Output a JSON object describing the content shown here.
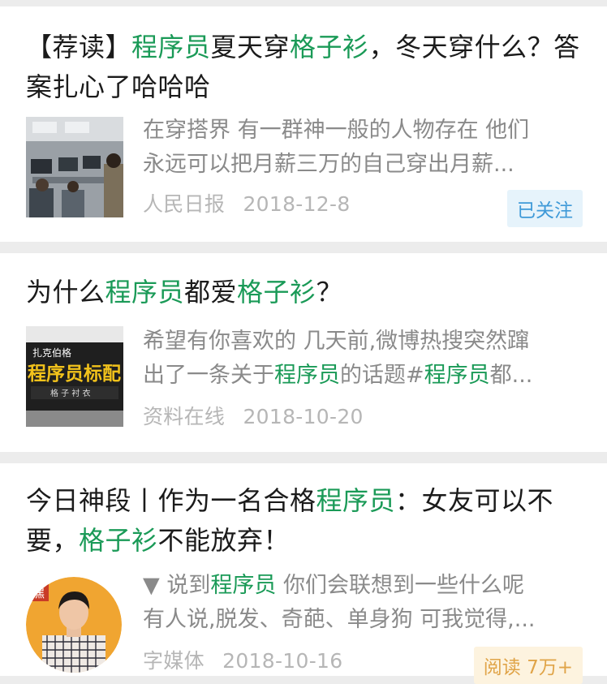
{
  "articles": [
    {
      "title_parts": [
        {
          "text": "【荐读】",
          "hl": false
        },
        {
          "text": "程序员",
          "hl": true
        },
        {
          "text": "夏天穿",
          "hl": false
        },
        {
          "text": "格子衫",
          "hl": true
        },
        {
          "text": "，冬天穿什么？答案扎心了哈哈哈",
          "hl": false
        }
      ],
      "summary_line1": [
        {
          "text": "在穿搭界 有一群神一般的人物存在 他们",
          "hl": false
        }
      ],
      "summary_line2": [
        {
          "text": "永远可以把月薪三万的自己穿出月薪...",
          "hl": false
        }
      ],
      "source": "人民日报",
      "date": "2018-12-8",
      "badge": "已关注"
    },
    {
      "title_parts": [
        {
          "text": "为什么",
          "hl": false
        },
        {
          "text": "程序员",
          "hl": true
        },
        {
          "text": "都爱",
          "hl": false
        },
        {
          "text": "格子衫",
          "hl": true
        },
        {
          "text": "？",
          "hl": false
        }
      ],
      "thumb_text": {
        "top_label": "扎克伯格",
        "main": "程序员标配",
        "sub": "格 子 衬 衣"
      },
      "summary_line1": [
        {
          "text": "希望有你喜欢的 几天前,微博热搜突然蹿",
          "hl": false
        }
      ],
      "summary_line2": [
        {
          "text": "出了一条关于",
          "hl": false
        },
        {
          "text": "程序员",
          "hl": true
        },
        {
          "text": "的话题#",
          "hl": false
        },
        {
          "text": "程序员",
          "hl": true
        },
        {
          "text": "都...",
          "hl": false
        }
      ],
      "source": "资料在线",
      "date": "2018-10-20",
      "badge": ""
    },
    {
      "title_parts": [
        {
          "text": "今日神段丨作为一名合格",
          "hl": false
        },
        {
          "text": "程序员",
          "hl": true
        },
        {
          "text": "：女友可以不要，",
          "hl": false
        },
        {
          "text": "格子衫",
          "hl": true
        },
        {
          "text": "不能放弃！",
          "hl": false
        }
      ],
      "thumb_text": {
        "tag": "嘿"
      },
      "summary_line1": [
        {
          "text": "▼ 说到",
          "hl": false
        },
        {
          "text": "程序员",
          "hl": true
        },
        {
          "text": " 你们会联想到一些什么呢",
          "hl": false
        }
      ],
      "summary_line2": [
        {
          "text": "有人说,脱发、奇葩、单身狗 可我觉得,...",
          "hl": false
        }
      ],
      "source": "字媒体",
      "date": "2018-10-16",
      "badge": "阅读 7万+"
    }
  ],
  "colors": {
    "highlight": "#1a9a57",
    "follow_badge_bg": "#e6f3fb",
    "follow_badge_text": "#3f9ad8",
    "read_badge_bg": "#fdf3df",
    "read_badge_text": "#e0a448"
  }
}
